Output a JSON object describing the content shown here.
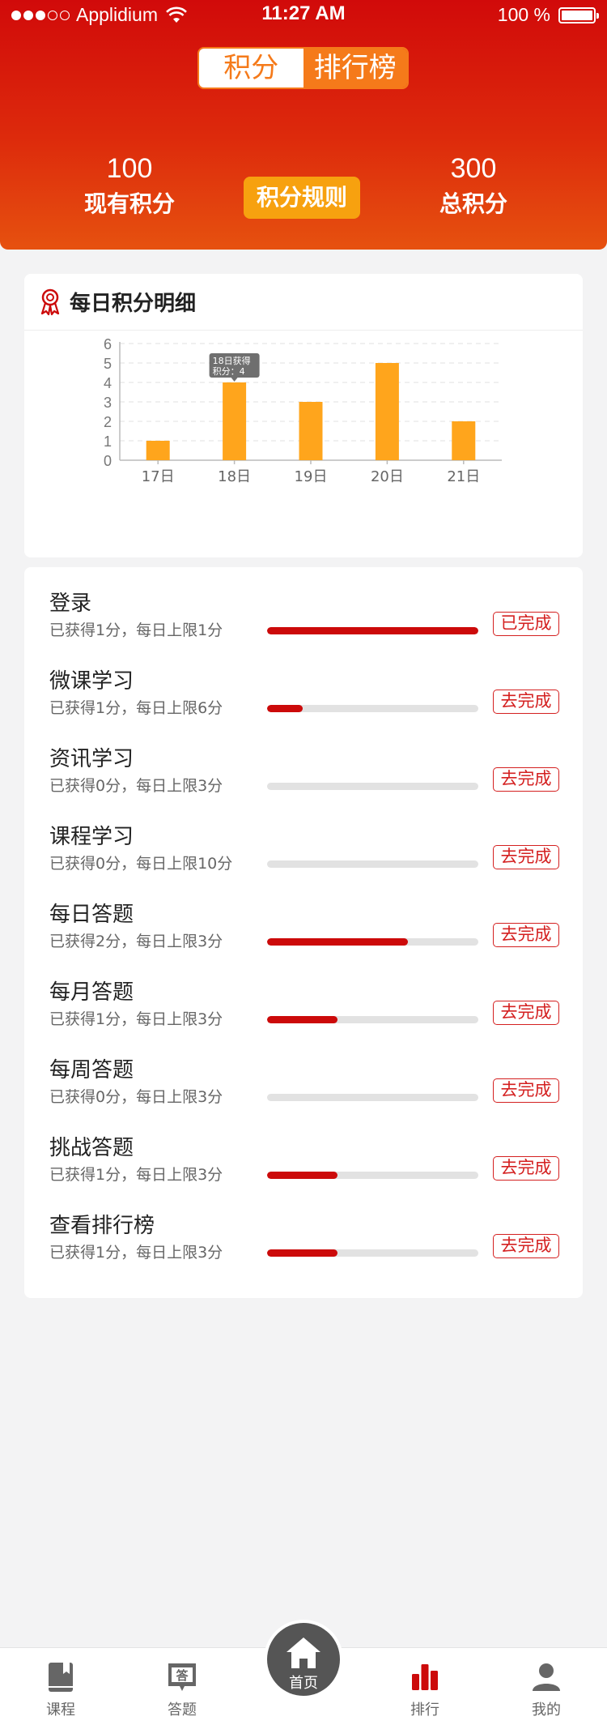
{
  "status_bar": {
    "carrier": "Applidium",
    "time": "11:27 AM",
    "battery_percent": "100 %"
  },
  "header": {
    "tabs": [
      {
        "label": "积分",
        "active": true
      },
      {
        "label": "排行榜",
        "active": false
      }
    ],
    "current_points": {
      "value": "100",
      "label": "现有积分"
    },
    "total_points": {
      "value": "300",
      "label": "总积分"
    },
    "rules_button": "积分规则"
  },
  "chart_section": {
    "title": "每日积分明细",
    "icon": "medal-icon"
  },
  "chart_data": {
    "type": "bar",
    "categories": [
      "17日",
      "18日",
      "19日",
      "20日",
      "21日"
    ],
    "values": [
      1,
      4,
      3,
      5,
      2
    ],
    "ylim": [
      0,
      6
    ],
    "yticks": [
      0,
      1,
      2,
      3,
      4,
      5,
      6
    ],
    "grid": true,
    "bar_color": "#ffa51c",
    "tooltip": {
      "category": "18日",
      "line1": "18日获得",
      "line2": "积分：4"
    }
  },
  "tasks": [
    {
      "name": "登录",
      "desc": "已获得1分，每日上限1分",
      "progress": 1.0,
      "button": "已完成"
    },
    {
      "name": "微课学习",
      "desc": "已获得1分，每日上限6分",
      "progress": 0.1667,
      "button": "去完成"
    },
    {
      "name": "资讯学习",
      "desc": "已获得0分，每日上限3分",
      "progress": 0,
      "button": "去完成"
    },
    {
      "name": "课程学习",
      "desc": "已获得0分，每日上限10分",
      "progress": 0,
      "button": "去完成"
    },
    {
      "name": "每日答题",
      "desc": "已获得2分，每日上限3分",
      "progress": 0.6667,
      "button": "去完成"
    },
    {
      "name": "每月答题",
      "desc": "已获得1分，每日上限3分",
      "progress": 0.3333,
      "button": "去完成"
    },
    {
      "name": "每周答题",
      "desc": "已获得0分，每日上限3分",
      "progress": 0,
      "button": "去完成"
    },
    {
      "name": "挑战答题",
      "desc": "已获得1分，每日上限3分",
      "progress": 0.3333,
      "button": "去完成"
    },
    {
      "name": "查看排行榜",
      "desc": "已获得1分，每日上限3分",
      "progress": 0.3333,
      "button": "去完成"
    }
  ],
  "tabbar": {
    "items": [
      {
        "label": "课程",
        "icon": "book-icon"
      },
      {
        "label": "答题",
        "icon": "quiz-icon"
      },
      {
        "label": "首页",
        "icon": "home-icon"
      },
      {
        "label": "排行",
        "icon": "ranking-icon",
        "active": true
      },
      {
        "label": "我的",
        "icon": "profile-icon"
      }
    ]
  },
  "colors": {
    "brand_red": "#cc0a0a",
    "accent_orange": "#f57a1a",
    "chart_bar": "#ffa51c"
  }
}
